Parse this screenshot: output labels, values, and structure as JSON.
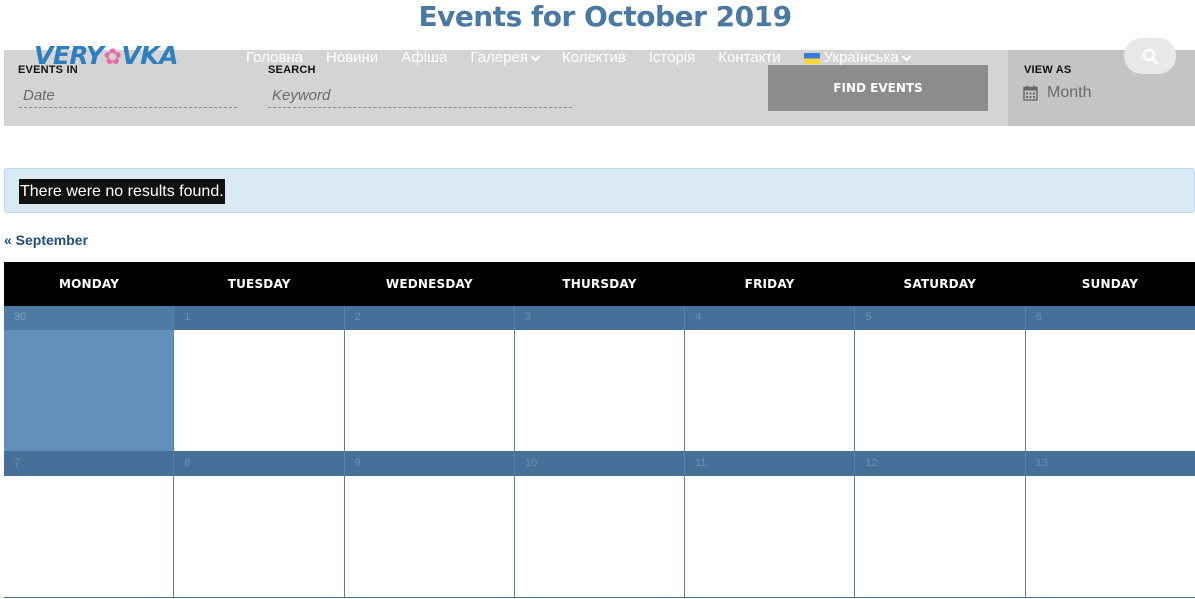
{
  "page": {
    "title": "Events for October 2019"
  },
  "site": {
    "logo_text_a": "VERY",
    "logo_text_b": "VKA"
  },
  "nav": {
    "items": [
      {
        "label": "Головна"
      },
      {
        "label": "Новини"
      },
      {
        "label": "Афіша"
      },
      {
        "label": "Галерея"
      },
      {
        "label": "Колектив"
      },
      {
        "label": "Історія"
      },
      {
        "label": "Контакти"
      },
      {
        "label": "Українська"
      }
    ]
  },
  "filters": {
    "events_in_label": "EVENTS IN",
    "date_placeholder": "Date",
    "search_label": "SEARCH",
    "keyword_placeholder": "Keyword",
    "find_button": "FIND EVENTS",
    "view_as_label": "VIEW AS",
    "view_as_value": "Month"
  },
  "notice": {
    "text": "There were no results found."
  },
  "navigation": {
    "previous_month": "« September"
  },
  "calendar": {
    "weekdays": [
      "MONDAY",
      "TUESDAY",
      "WEDNESDAY",
      "THURSDAY",
      "FRIDAY",
      "SATURDAY",
      "SUNDAY"
    ],
    "weeks": [
      [
        "30",
        "1",
        "2",
        "3",
        "4",
        "5",
        "6"
      ],
      [
        "7",
        "8",
        "9",
        "10",
        "11",
        "12",
        "13"
      ]
    ]
  },
  "colors": {
    "title": "#4a7aa3",
    "filter_bar": "#d4d4d4",
    "button": "#8c8c8c",
    "notice_bg": "#d9eaf5",
    "day_header": "#46709a",
    "past_day": "#6390bb"
  }
}
